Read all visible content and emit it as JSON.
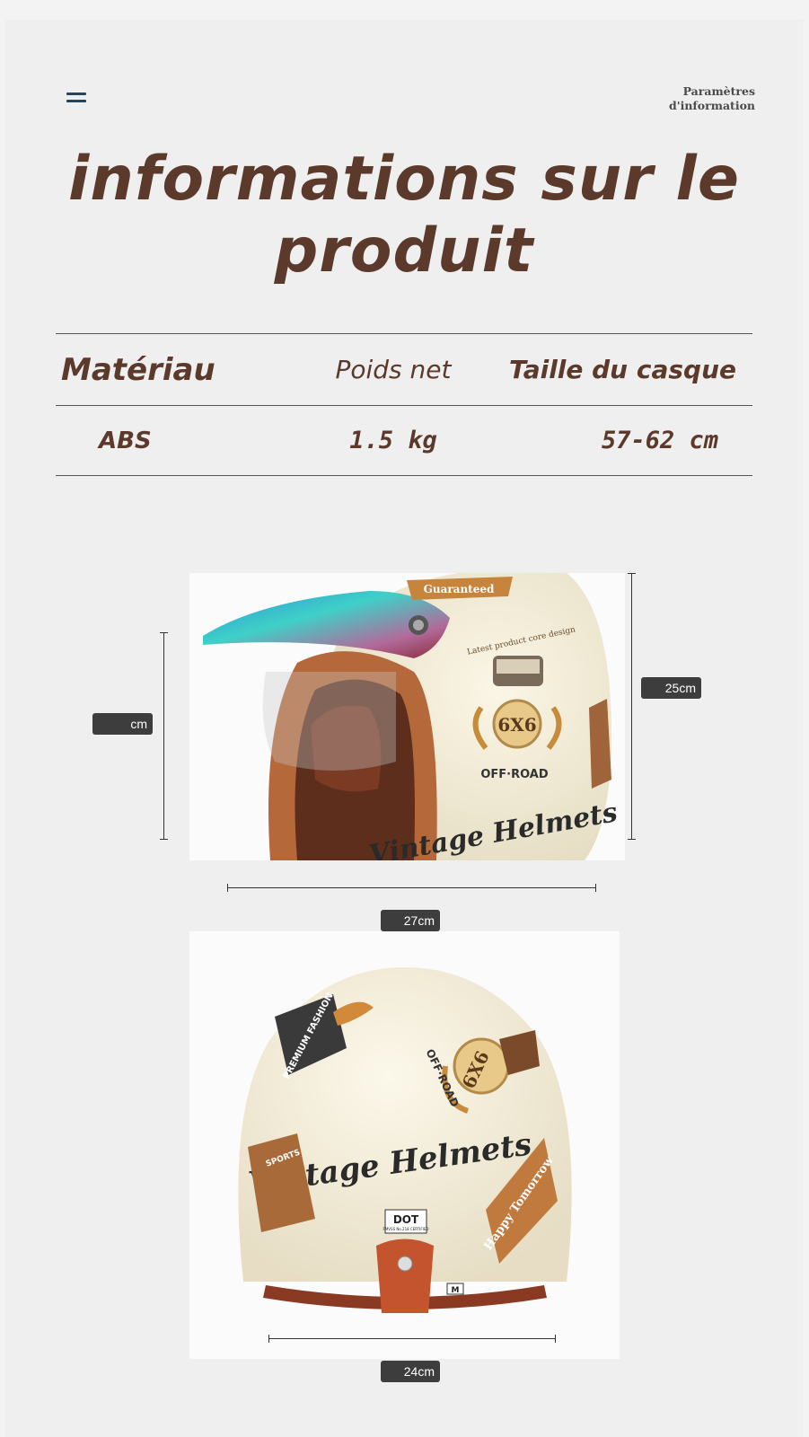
{
  "header": {
    "params_link": "Paramètres d'information",
    "title": "informations sur le produit"
  },
  "specs": {
    "headers": [
      "Matériau",
      "Poids net",
      "Taille du casque"
    ],
    "values": [
      "ABS",
      "1.5 kg",
      "57-62 cm"
    ]
  },
  "side_view": {
    "visor_label": "Guaranteed",
    "badge_top": "Latest product core design",
    "badge_center": "6X6",
    "badge_sub": "OFF·ROAD",
    "script_text": "Vintage Helmets",
    "dim_height_left": "cm",
    "dim_height_right": "25cm",
    "dim_length": "27cm"
  },
  "back_view": {
    "sticker_premium": "PREMIUM FASHION",
    "badge_center": "6X6",
    "badge_sub": "OFF·ROAD",
    "script_text": "Vintage Helmets",
    "sticker_sports": "SPORTS",
    "sticker_happy": "Happy Tomorrow",
    "dot_label": "DOT",
    "dot_sub": "FMVSS No.218 CERTIFIED",
    "size_tag": "M",
    "dim_width": "24cm"
  },
  "colors": {
    "title_brown": "#5b3a2c",
    "menu_blue": "#23455e",
    "helmet_cream": "#f3ecd8",
    "leather_brown": "#b5683a"
  }
}
